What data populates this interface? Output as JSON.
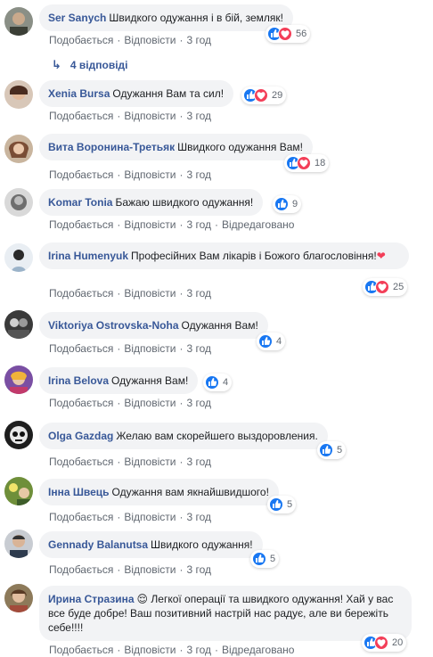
{
  "actions": {
    "like": "Подобається",
    "reply": "Відповісти",
    "edited": "Відредаговано"
  },
  "replies_label": "4 відповіді",
  "comments": [
    {
      "author": "Ser Sanych",
      "text": "Швидкого одужання і в бій, земляк!",
      "time": "3 год",
      "count": "56",
      "love": true,
      "edited": false
    },
    {
      "author": "Xenia Bursa",
      "text": "Одужання Вам та сил!",
      "time": "3 год",
      "count": "29",
      "love": true,
      "edited": false
    },
    {
      "author": "Вита Воронина-Третьяк",
      "text": "Швидкого одужання Вам!",
      "time": "3 год",
      "count": "18",
      "love": true,
      "edited": false
    },
    {
      "author": "Komar Tonia",
      "text": "Бажаю швидкого одужання!",
      "time": "3 год",
      "count": "9",
      "love": false,
      "edited": true
    },
    {
      "author": "Irina Humenyuk",
      "text": "Професійних Вам лікарів і Божого благословіння!",
      "time": "3 год",
      "count": "25",
      "love": true,
      "edited": false
    },
    {
      "author": "Viktoriya Ostrovska-Noha",
      "text": "Одужання Вам!",
      "time": "3 год",
      "count": "4",
      "love": false,
      "edited": false
    },
    {
      "author": "Irina Belova",
      "text": "Одужання Вам!",
      "time": "3 год",
      "count": "4",
      "love": false,
      "edited": false
    },
    {
      "author": "Olga Gazdag",
      "text": "Желаю вам скорейшего выздоровления.",
      "time": "3 год",
      "count": "5",
      "love": false,
      "edited": false
    },
    {
      "author": "Інна Швець",
      "text": "Одужання вам якнайшвидшого!",
      "time": "3 год",
      "count": "5",
      "love": false,
      "edited": false
    },
    {
      "author": "Gennady Balanutsa",
      "text": "Швидкого одужання!",
      "time": "3 год",
      "count": "5",
      "love": false,
      "edited": false
    },
    {
      "author": "Ирина Стразина",
      "text": "😌 Легкої операції та швидкого одужання! Хай у вас все буде добре! Ваш позитивний настрій нас радує, але ви бережіть себе!!!!",
      "time": "3 год",
      "count": "20",
      "love": true,
      "edited": true
    }
  ],
  "colors": {
    "author": "#385898",
    "bubble": "#f2f3f5",
    "like": "#1877f2",
    "love": "#f33e58",
    "meta": "#606770"
  },
  "icons": {
    "like": "thumbs-up-icon",
    "love": "heart-icon",
    "reply_arrow": "reply-arrow-icon",
    "inline_heart": "red-heart-emoji"
  }
}
